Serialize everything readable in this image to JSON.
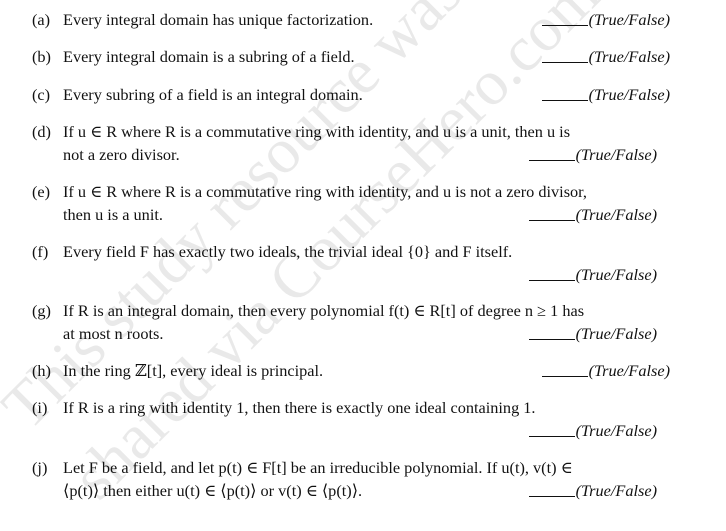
{
  "document": {
    "answer_placeholder": "",
    "answer_label": "(True/False)",
    "questions": [
      {
        "label": "(a)",
        "text": "Every integral domain has unique factorization."
      },
      {
        "label": "(b)",
        "text": "Every integral domain is a subring of a field."
      },
      {
        "label": "(c)",
        "text": "Every subring of a field is an integral domain."
      },
      {
        "label": "(d)",
        "line1": "If u ∈ R where R is a commutative ring with identity, and u is a unit, then u is",
        "line2": "not a zero divisor."
      },
      {
        "label": "(e)",
        "line1": "If u ∈ R where R is a commutative ring with identity, and u is not a zero divisor,",
        "line2": "then u is a unit."
      },
      {
        "label": "(f)",
        "line1": "Every field F has exactly two ideals, the trivial ideal {0} and F itself.",
        "line2": ""
      },
      {
        "label": "(g)",
        "line1": "If R is an integral domain, then every polynomial f(t) ∈ R[t] of degree n ≥ 1 has",
        "line2": "at most n roots."
      },
      {
        "label": "(h)",
        "text": "In the ring ℤ[t], every ideal is principal."
      },
      {
        "label": "(i)",
        "line1": "If R is a ring with identity 1, then there is exactly one ideal containing 1.",
        "line2": ""
      },
      {
        "label": "(j)",
        "line1": "Let F be a field, and let p(t) ∈ F[t] be an irreducible polynomial. If u(t), v(t) ∈",
        "line2": "⟨p(t)⟩ then either u(t) ∈ ⟨p(t)⟩ or v(t) ∈ ⟨p(t)⟩."
      }
    ]
  },
  "watermark": {
    "line1": "This study resource was",
    "line2": "shared via CourseHero.com"
  }
}
